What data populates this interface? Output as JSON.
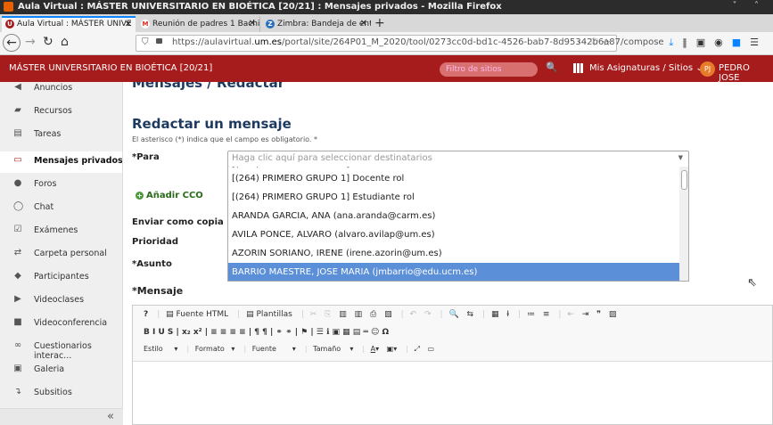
{
  "window": {
    "title": "Aula Virtual : MÁSTER UNIVERSITARIO EN BIOÉTICA [20/21] : Mensajes privados - Mozilla Firefox",
    "controls": "˅ ˄"
  },
  "tabs": [
    {
      "label": "Aula Virtual : MÁSTER UNIVE",
      "favicon": "um-icon",
      "fav_color": "#a61b1b",
      "fav_letter": "U"
    },
    {
      "label": "Reunión de padres 1 Bachille",
      "favicon": "gmail-icon",
      "fav_color": "#d93025",
      "fav_letter": "M"
    },
    {
      "label": "Zimbra: Bandeja de entrada |",
      "favicon": "zimbra-icon",
      "fav_color": "#2a6fbe",
      "fav_letter": "Z"
    }
  ],
  "toolbar": {
    "url_prefix": "https://aulavirtual.",
    "url_domain": "um.es",
    "url_suffix": "/portal/site/264P01_M_2020/tool/0273cc0d-bd1c-4526-bab7-8d95342b6a87/compose",
    "page_actions": "··· ♡ ☆",
    "right_icons": "⤓ ‖ ▣ ◉ ■ ☰"
  },
  "site": {
    "title": "MÁSTER UNIVERSITARIO EN BIOÉTICA [20/21]",
    "filter_placeholder": "Filtro de sitios",
    "my_courses": "Mis Asignaturas / Sitios ⌄",
    "user_initials": "PJ",
    "user_name": "PEDRO JOSE"
  },
  "sidebar": {
    "items": [
      {
        "label": "Anuncios",
        "icon": "megaphone-icon",
        "glyph": "◀"
      },
      {
        "label": "Recursos",
        "icon": "folder-icon",
        "glyph": "▰"
      },
      {
        "label": "Tareas",
        "icon": "document-icon",
        "glyph": "▤"
      },
      {
        "label": "Mensajes privados",
        "icon": "message-icon",
        "glyph": "▭",
        "active": true
      },
      {
        "label": "Foros",
        "icon": "chat-bubbles-icon",
        "glyph": "●"
      },
      {
        "label": "Chat",
        "icon": "chat-icon",
        "glyph": "◯"
      },
      {
        "label": "Exámenes",
        "icon": "checkbox-icon",
        "glyph": "☑"
      },
      {
        "label": "Carpeta personal",
        "icon": "exchange-icon",
        "glyph": "⇄"
      },
      {
        "label": "Participantes",
        "icon": "users-icon",
        "glyph": "👥"
      },
      {
        "label": "Videoclases",
        "icon": "play-icon",
        "glyph": "▶"
      },
      {
        "label": "Videoconferencia",
        "icon": "video-camera-icon",
        "glyph": "■"
      },
      {
        "label": "Cuestionarios interac...",
        "icon": "glasses-icon",
        "glyph": "∞"
      },
      {
        "label": "Galeria",
        "icon": "image-icon",
        "glyph": "▣"
      },
      {
        "label": "Subsitios",
        "icon": "subsite-icon",
        "glyph": "↴"
      }
    ],
    "collapse": "«"
  },
  "main": {
    "breadcrumb": "Mensajes / Redactar",
    "heading": "Redactar un mensaje",
    "required_note": "El asterisco (*) indica que el campo es obligatorio. *",
    "labels": {
      "para": "*Para",
      "add_cco": "Añadir CCO",
      "copia": "Enviar como copia",
      "prioridad": "Prioridad",
      "asunto": "*Asunto",
      "mensaje": "*Mensaje"
    },
    "para_placeholder": "Haga clic aquí para seleccionar destinatarios",
    "recipients": [
      "[(264) PRIMERO GRUPO 1] Docente rol",
      "[(264) PRIMERO GRUPO 1] Estudiante rol",
      "ARANDA GARCIA, ANA (ana.aranda@carm.es)",
      "AVILA PONCE, ALVARO (alvaro.avilap@um.es)",
      "AZORIN SORIANO, IRENE (irene.azorin@um.es)",
      "BARRIO MAESTRE, JOSE MARIA (jmbarrio@edu.ucm.es)"
    ]
  },
  "editor": {
    "fuente_html": "Fuente HTML",
    "plantillas": "Plantillas",
    "row2": "B  I  U  S  |  x₂  x²  |  ≡  ≡  ≡  ≡  |  ¶  ¶  |  ⚭  ⚭  |  ⚑  |  ☰  ℹ  ▣  ▦  ▤  ═  ☺  Ω",
    "estilo": "Estilo",
    "formato": "Formato",
    "fuente": "Fuente",
    "tamano": "Tamaño"
  }
}
